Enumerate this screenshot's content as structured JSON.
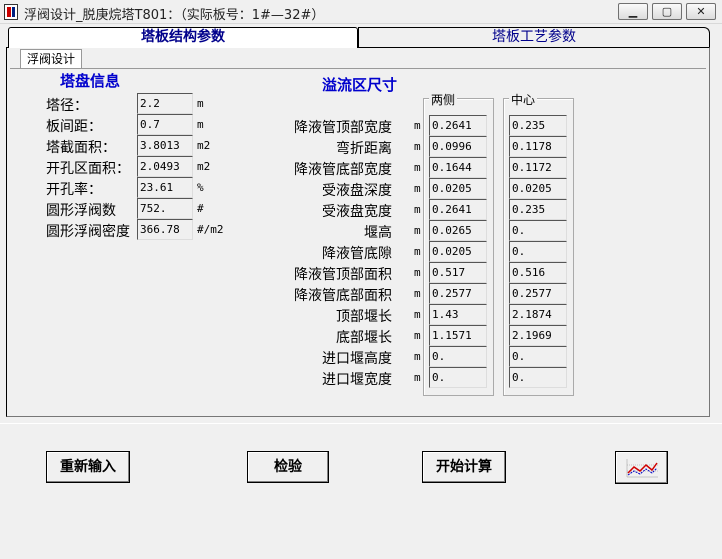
{
  "window": {
    "title": "浮阀设计_脱庚烷塔T801：（实际板号：1#—32#）",
    "minimize": "▁",
    "restore": "▢",
    "close": "✕"
  },
  "tabs": [
    {
      "label": "塔板结构参数",
      "active": true
    },
    {
      "label": "塔板工艺参数",
      "active": false
    }
  ],
  "subtab": {
    "label": "浮阀设计"
  },
  "tray_info": {
    "heading": "塔盘信息",
    "rows": [
      {
        "label": "塔径：",
        "value": "2.2",
        "unit": "m"
      },
      {
        "label": "板间距：",
        "value": "0.7",
        "unit": "m"
      },
      {
        "label": "塔截面积：",
        "value": "3.8013",
        "unit": "m2"
      },
      {
        "label": "开孔区面积：",
        "value": "2.0493",
        "unit": "m2"
      },
      {
        "label": "开孔率：",
        "value": "23.61",
        "unit": "%"
      },
      {
        "label": "圆形浮阀数",
        "value": "752.",
        "unit": "#"
      },
      {
        "label": "圆形浮阀密度",
        "value": "366.78",
        "unit": "#/m2"
      }
    ]
  },
  "overflow": {
    "heading": "溢流区尺寸",
    "col_side": "两侧",
    "col_center": "中心",
    "rows": [
      {
        "label": "降液管顶部宽度",
        "unit": "m",
        "side": "0.2641",
        "center": "0.235"
      },
      {
        "label": "弯折距离",
        "unit": "m",
        "side": "0.0996",
        "center": "0.1178"
      },
      {
        "label": "降液管底部宽度",
        "unit": "m",
        "side": "0.1644",
        "center": "0.1172"
      },
      {
        "label": "受液盘深度",
        "unit": "m",
        "side": "0.0205",
        "center": "0.0205"
      },
      {
        "label": "受液盘宽度",
        "unit": "m",
        "side": "0.2641",
        "center": "0.235"
      },
      {
        "label": "堰高",
        "unit": "m",
        "side": "0.0265",
        "center": "0."
      },
      {
        "label": "降液管底隙",
        "unit": "m",
        "side": "0.0205",
        "center": "0."
      },
      {
        "label": "降液管顶部面积",
        "unit": "m",
        "side": "0.517",
        "center": "0.516"
      },
      {
        "label": "降液管底部面积",
        "unit": "m",
        "side": "0.2577",
        "center": "0.2577"
      },
      {
        "label": "顶部堰长",
        "unit": "m",
        "side": "1.43",
        "center": "2.1874"
      },
      {
        "label": "底部堰长",
        "unit": "m",
        "side": "1.1571",
        "center": "2.1969"
      },
      {
        "label": "进口堰高度",
        "unit": "m",
        "side": "0.",
        "center": "0."
      },
      {
        "label": "进口堰宽度",
        "unit": "m",
        "side": "0.",
        "center": "0."
      }
    ]
  },
  "buttons": {
    "reset": "重新输入",
    "check": "检验",
    "calculate": "开始计算",
    "chart_icon": "line-chart-icon"
  },
  "colors": {
    "heading": "#0000cd",
    "tab_text": "#00008b",
    "chart_line": "#d00000",
    "chart_points": "#0000c0"
  }
}
